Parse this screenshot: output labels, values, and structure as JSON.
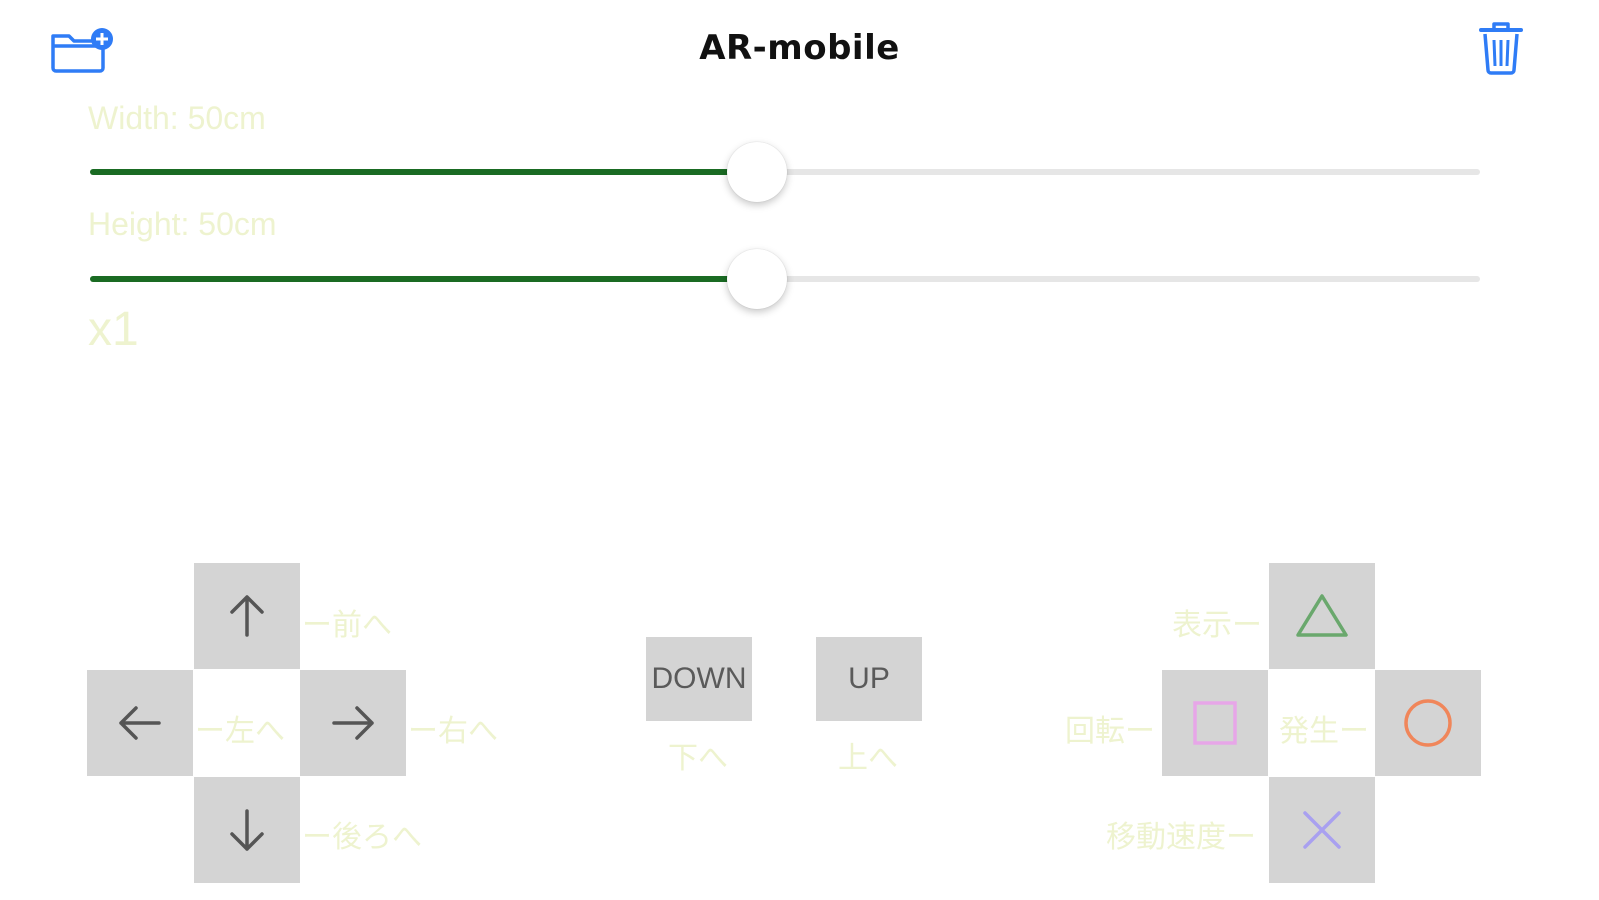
{
  "nav": {
    "title": "AR-mobile",
    "left_icon": "folder-add-icon",
    "right_icon": "trash-icon",
    "icon_color": "#2f7cf6"
  },
  "sliders": {
    "width": {
      "label": "Width: 50cm",
      "value_fraction": 0.48
    },
    "height": {
      "label": "Height: 50cm",
      "value_fraction": 0.48
    }
  },
  "speed": {
    "label": "x1"
  },
  "dpad": {
    "up": {
      "icon": "arrow-up-icon",
      "label": "ー前へ"
    },
    "left": {
      "icon": "arrow-left-icon",
      "label": "ー左へ"
    },
    "right": {
      "icon": "arrow-right-icon",
      "label": "ー右へ"
    },
    "down": {
      "icon": "arrow-down-icon",
      "label": "ー後ろへ"
    }
  },
  "vertical": {
    "down": {
      "text": "DOWN",
      "label": "下へ"
    },
    "up": {
      "text": "UP",
      "label": "上へ"
    }
  },
  "actions": {
    "triangle": {
      "icon": "triangle-icon",
      "label": "表示ー",
      "color": "#6aa86d"
    },
    "square": {
      "icon": "square-icon",
      "label": "回転ー",
      "color": "#e7a6e8"
    },
    "circle": {
      "icon": "circle-icon",
      "label": "発生ー",
      "color": "#f0865a"
    },
    "cross": {
      "icon": "cross-icon",
      "label": "移動速度ー",
      "color": "#a9a0f0"
    }
  },
  "colors": {
    "slider_fill": "#1a6b23",
    "label_faint": "#eef3cf",
    "button_gray": "#d4d4d4"
  }
}
